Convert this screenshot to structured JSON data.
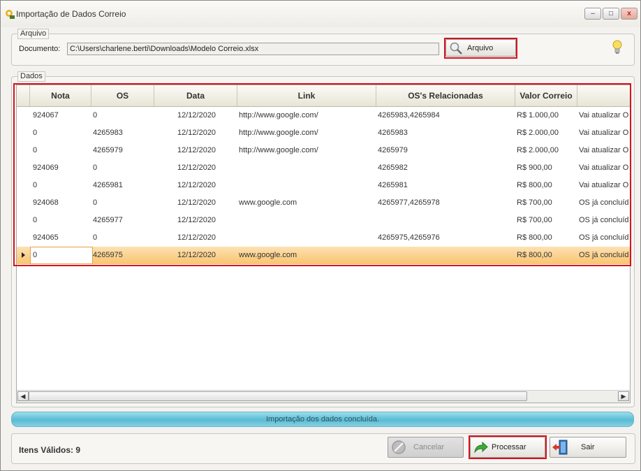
{
  "window": {
    "title": "Importação de Dados Correio",
    "minimize_label": "–",
    "maximize_label": "□",
    "close_label": "x"
  },
  "arquivo": {
    "legend": "Arquivo",
    "document_label": "Documento:",
    "document_value": "C:\\Users\\charlene.berti\\Downloads\\Modelo Correio.xlsx",
    "button_label": "Arquivo"
  },
  "dados": {
    "legend": "Dados"
  },
  "grid": {
    "columns": [
      "Nota",
      "OS",
      "Data",
      "Link",
      "OS's Relacionadas",
      "Valor Correio",
      ""
    ],
    "rows": [
      [
        "924067",
        "0",
        "12/12/2020",
        "http://www.google.com/",
        "4265983,4265984",
        "R$ 1.000,00",
        "Vai atualizar O"
      ],
      [
        "0",
        "4265983",
        "12/12/2020",
        "http://www.google.com/",
        "4265983",
        "R$ 2.000,00",
        "Vai atualizar O"
      ],
      [
        "0",
        "4265979",
        "12/12/2020",
        "http://www.google.com/",
        "4265979",
        "R$ 2.000,00",
        "Vai atualizar O"
      ],
      [
        "924069",
        "0",
        "12/12/2020",
        "",
        "4265982",
        "R$ 900,00",
        "Vai atualizar O"
      ],
      [
        "0",
        "4265981",
        "12/12/2020",
        "",
        "4265981",
        "R$ 800,00",
        "Vai atualizar O"
      ],
      [
        "924068",
        "0",
        "12/12/2020",
        "www.google.com",
        "4265977,4265978",
        "R$ 700,00",
        "OS já concluíd"
      ],
      [
        "0",
        "4265977",
        "12/12/2020",
        "",
        "",
        "R$ 700,00",
        "OS já concluíd"
      ],
      [
        "924065",
        "0",
        "12/12/2020",
        "",
        "4265975,4265976",
        "R$ 800,00",
        "OS já concluíd"
      ],
      [
        "0",
        "4265975",
        "12/12/2020",
        "www.google.com",
        "",
        "R$ 800,00",
        "OS já concluíd"
      ]
    ],
    "selected_row": 8,
    "scroll_left_label": "◀",
    "scroll_right_label": "▶"
  },
  "status": {
    "text": "Importação dos dados concluída.",
    "progress_fraction": 1.0
  },
  "footer": {
    "valid_items": "Itens Válidos: 9",
    "cancel_label": "Cancelar",
    "process_label": "Processar",
    "exit_label": "Sair"
  },
  "colors": {
    "highlight": "#d6131e",
    "selection": "#f9c46f",
    "progress": "#58bcd4"
  }
}
